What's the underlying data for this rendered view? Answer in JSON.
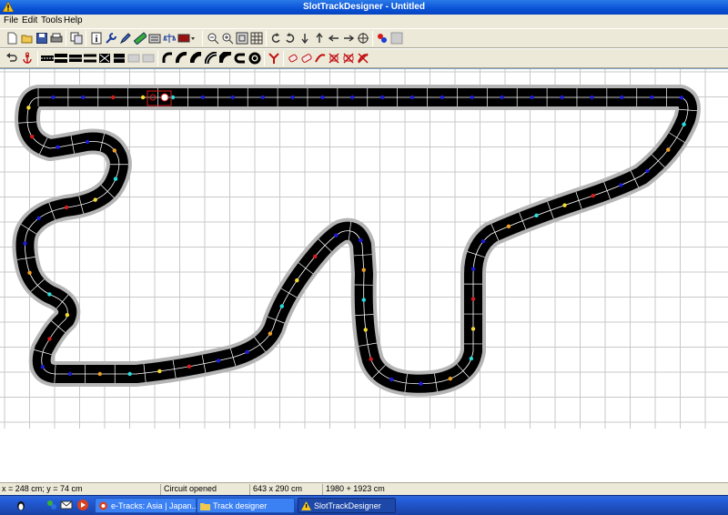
{
  "window": {
    "title": "SlotTrackDesigner - Untitled"
  },
  "menu": [
    {
      "label": "File"
    },
    {
      "label": "Edit"
    },
    {
      "label": "Tools"
    },
    {
      "label": "Help"
    }
  ],
  "toolbar1": {
    "buttons": [
      {
        "name": "new-button",
        "icon": "new-document-icon"
      },
      {
        "name": "open-button",
        "icon": "folder-open-icon"
      },
      {
        "name": "save-button",
        "icon": "floppy-disk-icon"
      },
      {
        "name": "print-button",
        "icon": "printer-icon"
      },
      {
        "name": "copy-button",
        "icon": "copy-icon"
      },
      {
        "name": "info-button",
        "icon": "info-icon"
      },
      {
        "name": "tools-button",
        "icon": "wrench-icon"
      },
      {
        "name": "pen-button",
        "icon": "pen-icon"
      },
      {
        "name": "ruler-button",
        "icon": "ruler-icon"
      },
      {
        "name": "export-button",
        "icon": "export-icon"
      },
      {
        "name": "balance-button",
        "icon": "scales-icon"
      },
      {
        "name": "color-button",
        "icon": "color-swatch-icon"
      },
      {
        "name": "zoom-out-button",
        "icon": "zoom-out-icon"
      },
      {
        "name": "zoom-in-button",
        "icon": "zoom-in-icon"
      },
      {
        "name": "zoom-fit-button",
        "icon": "zoom-fit-icon"
      },
      {
        "name": "grid-button",
        "icon": "grid-icon"
      },
      {
        "name": "rotate-left-button",
        "icon": "rotate-left-icon"
      },
      {
        "name": "rotate-right-button",
        "icon": "rotate-right-icon"
      },
      {
        "name": "move-down-button",
        "icon": "arrow-down-icon"
      },
      {
        "name": "move-up-button",
        "icon": "arrow-up-icon"
      },
      {
        "name": "move-left-button",
        "icon": "arrow-left-icon"
      },
      {
        "name": "move-right-button",
        "icon": "arrow-right-icon"
      },
      {
        "name": "move-all-button",
        "icon": "move-icon"
      },
      {
        "name": "paint-button",
        "icon": "paint-icon"
      },
      {
        "name": "clear-button",
        "icon": "blank-icon"
      }
    ]
  },
  "toolbar2": {
    "buttons": [
      {
        "name": "undo-button",
        "icon": "undo-icon"
      },
      {
        "name": "anchor-button",
        "icon": "anchor-icon"
      },
      {
        "name": "straight-track-button",
        "icon": "straight-track-icon"
      },
      {
        "name": "double-straight-button",
        "icon": "double-straight-icon"
      },
      {
        "name": "short-straight-button",
        "icon": "short-straight-icon"
      },
      {
        "name": "chicane-button",
        "icon": "chicane-icon"
      },
      {
        "name": "crossover-button",
        "icon": "crossover-icon"
      },
      {
        "name": "blank-piece-button",
        "icon": "blank-piece-icon"
      },
      {
        "name": "blank-piece-2-button",
        "icon": "blank-piece-icon"
      },
      {
        "name": "half-straight-button",
        "icon": "half-straight-icon"
      },
      {
        "name": "curve-1-button",
        "icon": "curve-icon"
      },
      {
        "name": "curve-2-button",
        "icon": "curve-icon"
      },
      {
        "name": "curve-3-button",
        "icon": "curve-icon"
      },
      {
        "name": "curve-4-button",
        "icon": "curve-icon"
      },
      {
        "name": "banked-curve-button",
        "icon": "banked-curve-icon"
      },
      {
        "name": "hairpin-button",
        "icon": "hairpin-icon"
      },
      {
        "name": "lane-change-button",
        "icon": "lane-change-icon"
      },
      {
        "name": "border-1-button",
        "icon": "border-icon"
      },
      {
        "name": "border-2-button",
        "icon": "border-icon"
      },
      {
        "name": "border-3-button",
        "icon": "border-icon"
      },
      {
        "name": "delete-border-1-button",
        "icon": "delete-border-icon"
      },
      {
        "name": "delete-border-2-button",
        "icon": "delete-border-icon"
      },
      {
        "name": "delete-border-3-button",
        "icon": "delete-border-icon"
      }
    ]
  },
  "status": {
    "coords": "x = 248 cm; y = 74 cm",
    "message": "Circuit opened",
    "size": "643 x 290 cm",
    "length": "1980 + 1923 cm"
  },
  "taskbar": {
    "tasks": [
      {
        "label": "e-Tracks: Asia | Japan...",
        "icon": "browser-icon",
        "active": false
      },
      {
        "label": "Track designer",
        "icon": "folder-icon",
        "active": false
      },
      {
        "label": "SlotTrackDesigner",
        "icon": "app-warning-icon",
        "active": true
      }
    ]
  },
  "colors": {
    "track": "#000000",
    "lane_line": "#ffffff",
    "border": "#b5b5b5",
    "dot_blue": "#1c1cd8",
    "dot_red": "#d81c1c",
    "dot_yellow": "#f5dc32",
    "dot_cyan": "#28dede",
    "dot_orange": "#f0a028",
    "title_bar": "#0a52d6"
  }
}
